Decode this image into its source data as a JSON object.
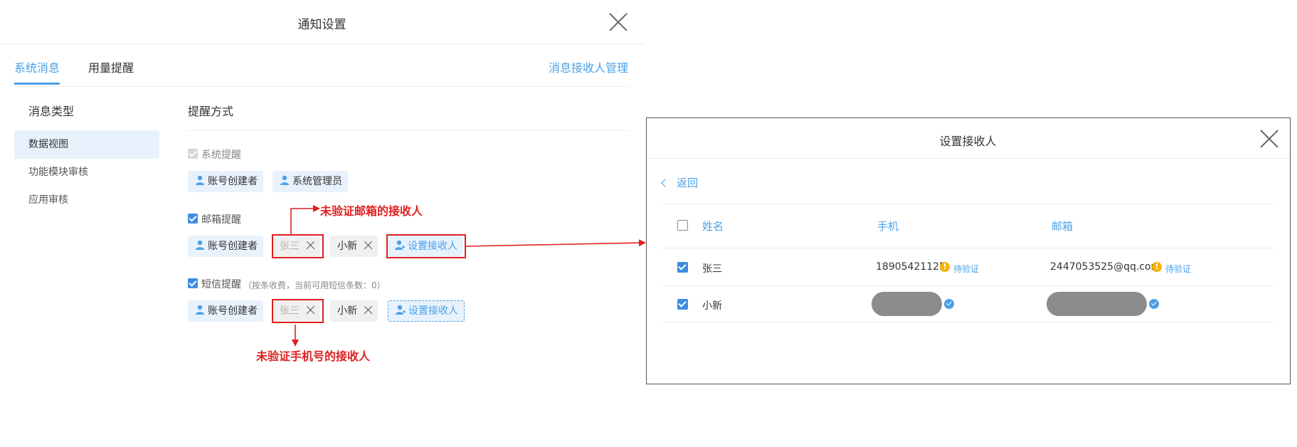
{
  "left_dialog": {
    "title": "通知设置",
    "tabs": [
      "系统消息",
      "用量提醒"
    ],
    "manage_link": "消息接收人管理",
    "category_heading": "消息类型",
    "categories": [
      "数据视图",
      "功能模块审核",
      "应用审核"
    ],
    "mode_heading": "提醒方式",
    "system_remind": {
      "label": "系统提醒",
      "chips": [
        "账号创建者",
        "系统管理员"
      ]
    },
    "email_remind": {
      "label": "邮箱提醒",
      "chips": [
        "账号创建者",
        "张三",
        "小新"
      ],
      "add_label": "设置接收人"
    },
    "sms_remind": {
      "label": "短信提醒",
      "note": "（按条收费，当前可用短信条数：0）",
      "chips": [
        "账号创建者",
        "张三",
        "小新"
      ],
      "add_label": "设置接收人"
    }
  },
  "annotations": {
    "email_unverified": "未验证邮箱的接收人",
    "phone_unverified": "未验证手机号的接收人",
    "color": "#e02020"
  },
  "right_dialog": {
    "title": "设置接收人",
    "back_label": "返回",
    "columns": [
      "姓名",
      "手机",
      "邮箱"
    ],
    "rows": [
      {
        "name": "张三",
        "phone": "18905421125",
        "phone_status": "待验证",
        "email": "2447053525@qq.com",
        "email_status": "待验证",
        "checked": true
      },
      {
        "name": "小新",
        "phone": "",
        "email": "",
        "phone_verified": true,
        "email_verified": true,
        "checked": true
      }
    ]
  },
  "colors": {
    "accent": "#4aa1e8",
    "checkbox": "#3e8ce0",
    "warning": "#f5b400",
    "chip_bg": "#e8f2fc"
  },
  "icons": [
    "close-icon",
    "user-icon",
    "add-user-icon",
    "chevron-left-icon",
    "warning-icon",
    "verified-icon"
  ]
}
